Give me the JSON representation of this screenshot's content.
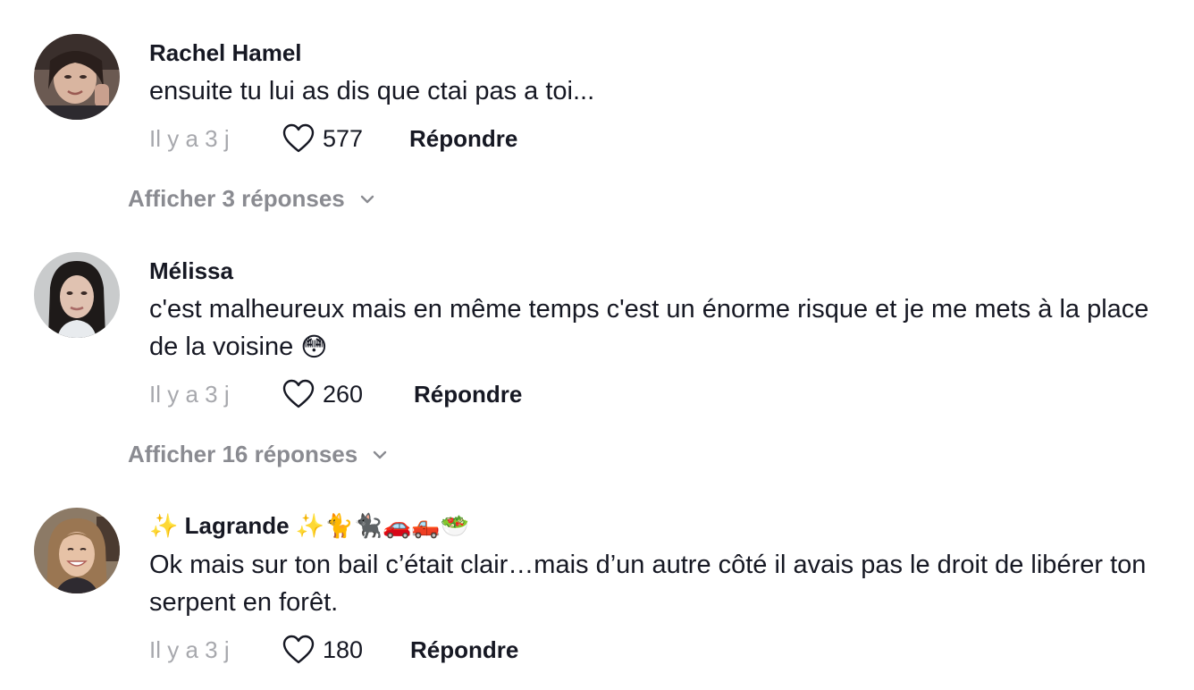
{
  "comments": [
    {
      "username": "Rachel Hamel",
      "text": "ensuite tu lui as dis que ctai pas a toi...",
      "time": "Il y a 3 j",
      "likes": "577",
      "reply_label": "Répondre",
      "replies_label": "Afficher 3 réponses"
    },
    {
      "username": "Mélissa",
      "text": "c'est malheureux mais en même temps c'est un énorme risque et je me mets à la place de la voisine",
      "emoji": "😳",
      "time": "Il y a 3 j",
      "likes": "260",
      "reply_label": "Répondre",
      "replies_label": "Afficher 16 réponses"
    },
    {
      "username_prefix": "✨",
      "username": "Lagrande",
      "username_suffix": "✨🐈🐈‍⬛🚗🛻🥗",
      "text": "Ok mais sur ton bail c’était clair…mais d’un autre côté il avais pas le droit de libérer ton serpent en forêt.",
      "time": "Il y a 3 j",
      "likes": "180",
      "reply_label": "Répondre"
    }
  ],
  "colors": {
    "text_primary": "#161823",
    "text_muted": "#a7a8ad",
    "replies_link": "#8a8b91",
    "background": "#ffffff"
  }
}
